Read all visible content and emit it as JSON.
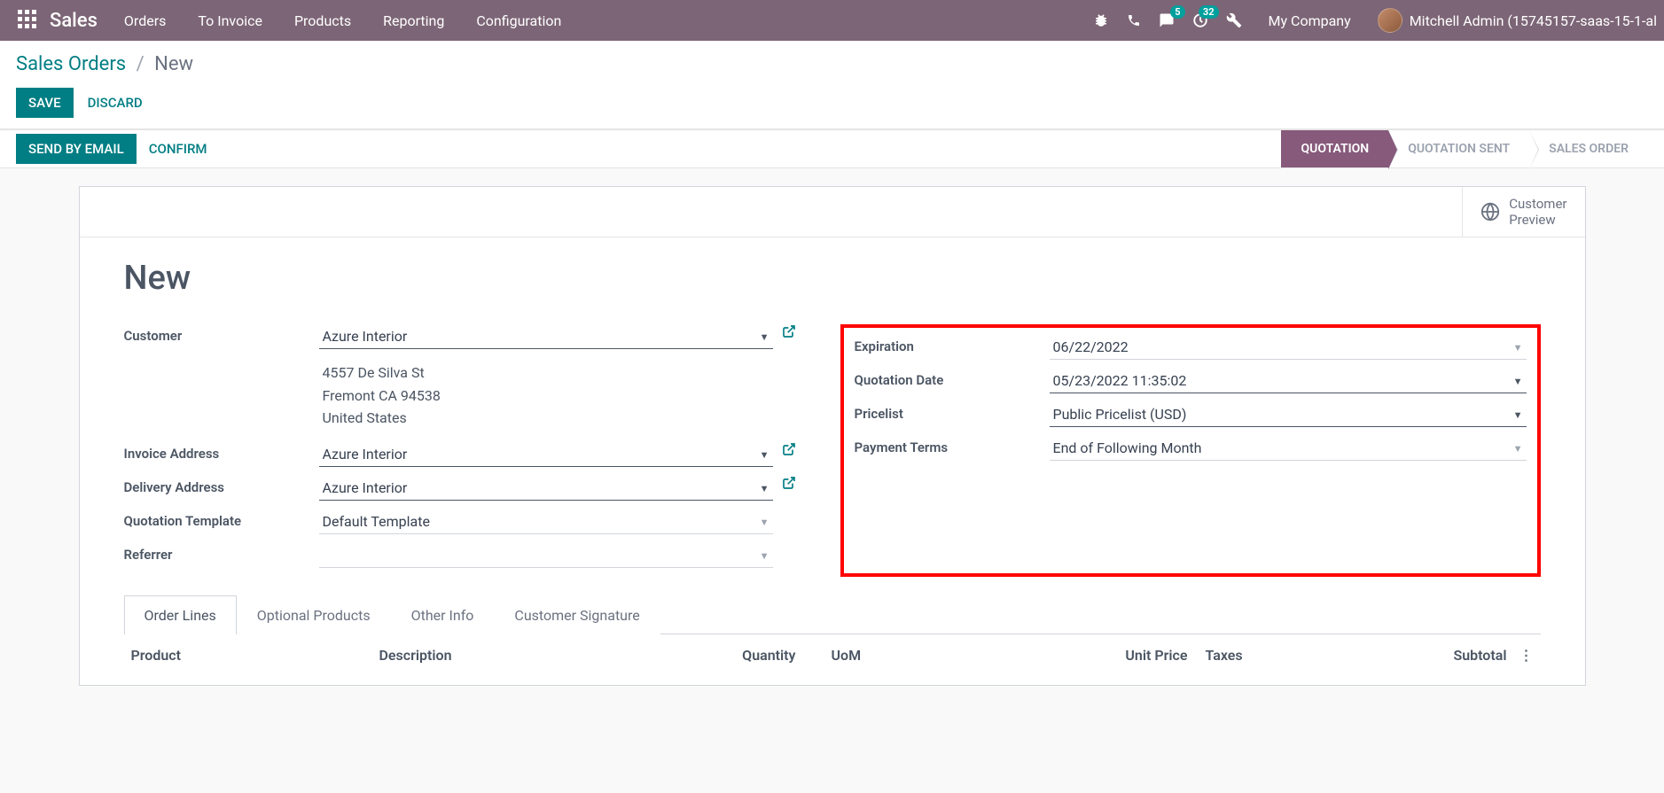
{
  "navbar": {
    "brand": "Sales",
    "links": [
      "Orders",
      "To Invoice",
      "Products",
      "Reporting",
      "Configuration"
    ],
    "msg_badge": "5",
    "activity_badge": "32",
    "company": "My Company",
    "username": "Mitchell Admin (15745157-saas-15-1-al"
  },
  "breadcrumb": {
    "root": "Sales Orders",
    "current": "New"
  },
  "buttons": {
    "save": "SAVE",
    "discard": "DISCARD",
    "send_email": "SEND BY EMAIL",
    "confirm": "CONFIRM"
  },
  "stages": [
    "QUOTATION",
    "QUOTATION SENT",
    "SALES ORDER"
  ],
  "stat_btn": {
    "line1": "Customer",
    "line2": "Preview"
  },
  "form": {
    "title": "New",
    "left": {
      "customer_label": "Customer",
      "customer_value": "Azure Interior",
      "addr1": "4557 De Silva St",
      "addr2": "Fremont CA 94538",
      "addr3": "United States",
      "invoice_label": "Invoice Address",
      "invoice_value": "Azure Interior",
      "delivery_label": "Delivery Address",
      "delivery_value": "Azure Interior",
      "template_label": "Quotation Template",
      "template_value": "Default Template",
      "referrer_label": "Referrer",
      "referrer_value": ""
    },
    "right": {
      "expiration_label": "Expiration",
      "expiration_value": "06/22/2022",
      "quote_date_label": "Quotation Date",
      "quote_date_value": "05/23/2022 11:35:02",
      "pricelist_label": "Pricelist",
      "pricelist_value": "Public Pricelist (USD)",
      "payment_label": "Payment Terms",
      "payment_value": "End of Following Month"
    }
  },
  "tabs": [
    "Order Lines",
    "Optional Products",
    "Other Info",
    "Customer Signature"
  ],
  "columns": {
    "product": "Product",
    "description": "Description",
    "quantity": "Quantity",
    "uom": "UoM",
    "unit_price": "Unit Price",
    "taxes": "Taxes",
    "subtotal": "Subtotal"
  }
}
